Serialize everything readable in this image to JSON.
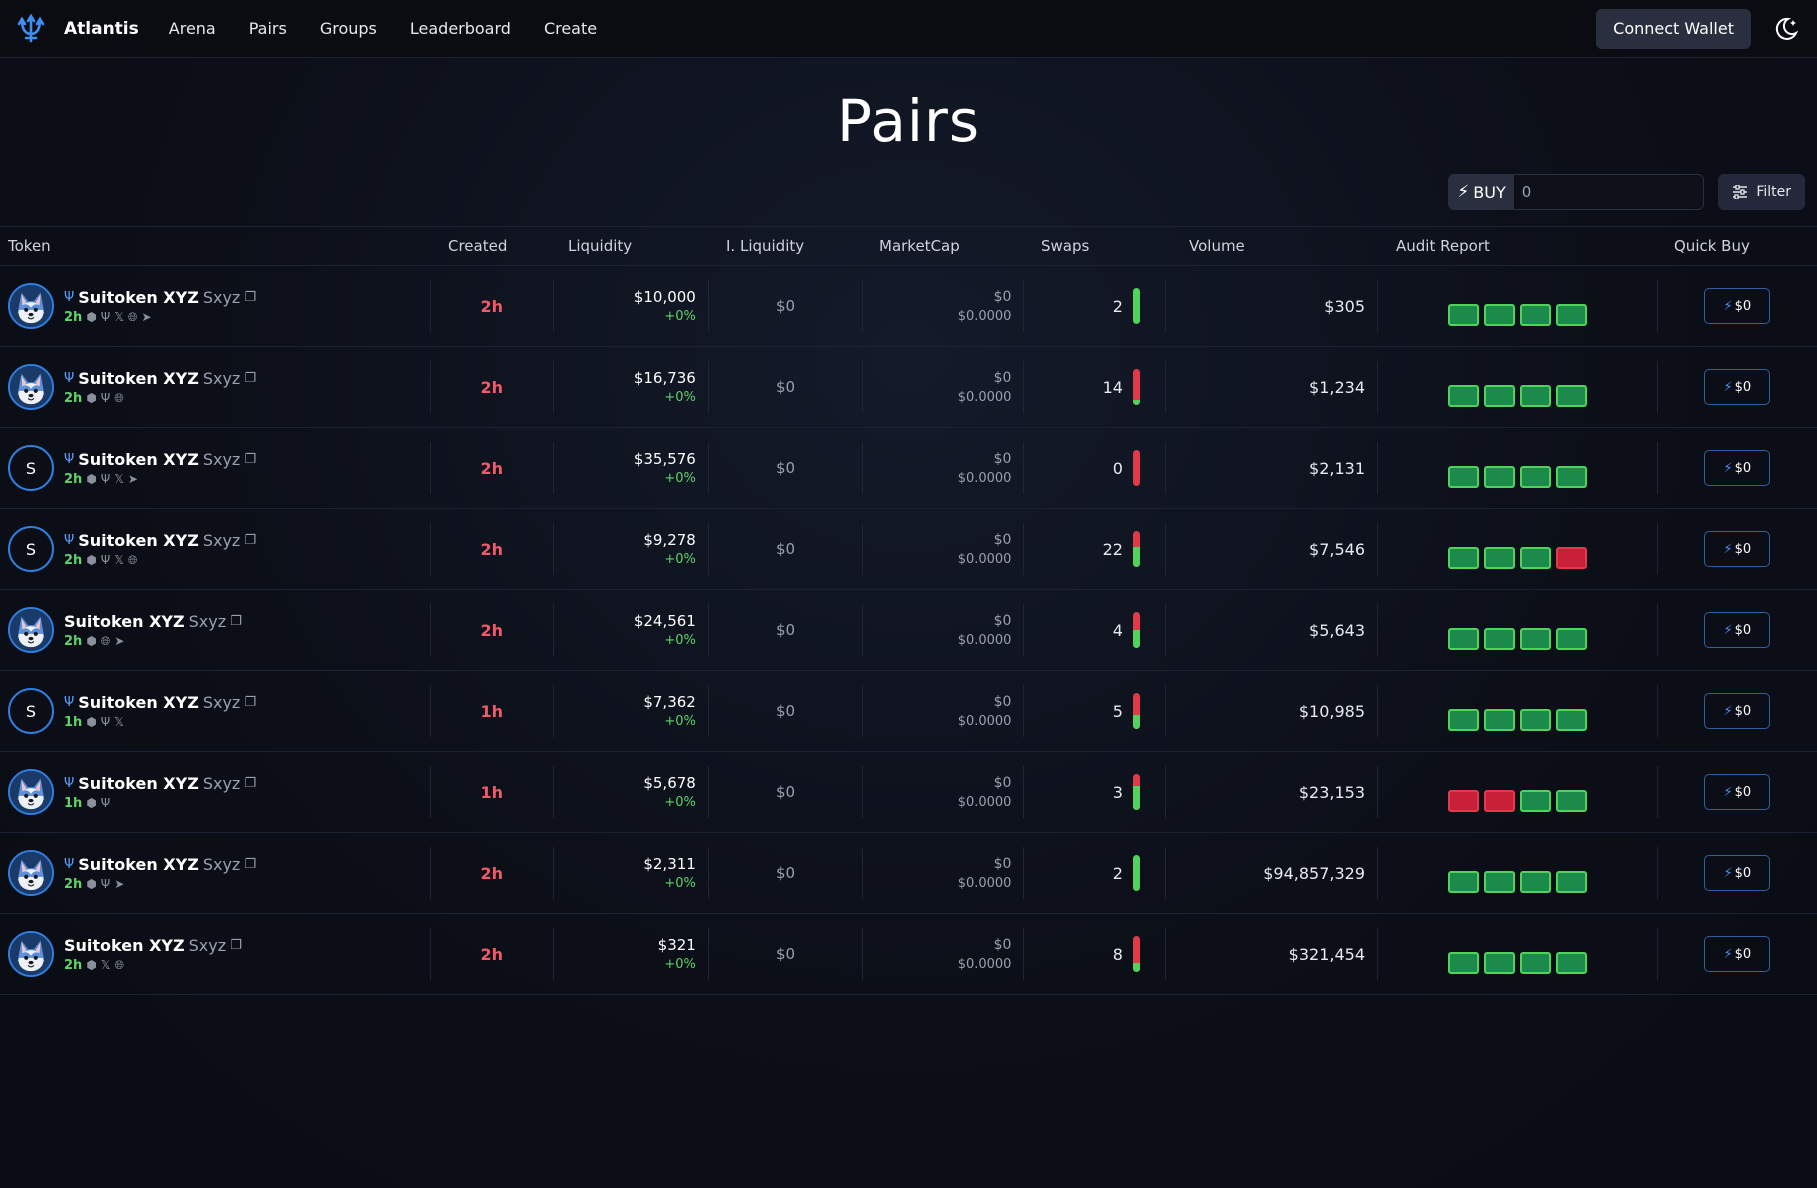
{
  "nav": {
    "brand": "Atlantis",
    "links": [
      "Arena",
      "Pairs",
      "Groups",
      "Leaderboard",
      "Create"
    ],
    "connect_label": "Connect Wallet"
  },
  "page": {
    "title": "Pairs"
  },
  "toolbar": {
    "buy_label": "BUY",
    "buy_value": "0",
    "filter_label": "Filter"
  },
  "table": {
    "headers": [
      "Token",
      "Created",
      "Liquidity",
      "I. Liquidity",
      "MarketCap",
      "Swaps",
      "Volume",
      "Audit Report",
      "Quick Buy"
    ],
    "rows": [
      {
        "avatar": "dog",
        "chain": true,
        "name": "Suitoken XYZ",
        "symbol": "Sxyz",
        "age": "2h",
        "socials": [
          "cube",
          "trident",
          "x",
          "globe",
          "telegram"
        ],
        "created": "2h",
        "liquidity": "$10,000",
        "liq_change": "+0%",
        "i_liquidity": "$0",
        "mcap": "$0",
        "price": "$0.0000",
        "swaps": "2",
        "swap_buy_ratio": 1.0,
        "volume": "$305",
        "audit": [
          "pass",
          "pass",
          "pass",
          "pass"
        ],
        "quick_buy": "$0"
      },
      {
        "avatar": "dog",
        "chain": true,
        "name": "Suitoken XYZ",
        "symbol": "Sxyz",
        "age": "2h",
        "socials": [
          "cube",
          "trident",
          "globe"
        ],
        "created": "2h",
        "liquidity": "$16,736",
        "liq_change": "+0%",
        "i_liquidity": "$0",
        "mcap": "$0",
        "price": "$0.0000",
        "swaps": "14",
        "swap_buy_ratio": 0.15,
        "volume": "$1,234",
        "audit": [
          "pass",
          "pass",
          "pass",
          "pass"
        ],
        "quick_buy": "$0"
      },
      {
        "avatar": "S",
        "chain": true,
        "name": "Suitoken XYZ",
        "symbol": "Sxyz",
        "age": "2h",
        "socials": [
          "cube",
          "trident",
          "x",
          "telegram"
        ],
        "created": "2h",
        "liquidity": "$35,576",
        "liq_change": "+0%",
        "i_liquidity": "$0",
        "mcap": "$0",
        "price": "$0.0000",
        "swaps": "0",
        "swap_buy_ratio": 0.0,
        "volume": "$2,131",
        "audit": [
          "pass",
          "pass",
          "pass",
          "pass"
        ],
        "quick_buy": "$0"
      },
      {
        "avatar": "S",
        "chain": true,
        "name": "Suitoken XYZ",
        "symbol": "Sxyz",
        "age": "2h",
        "socials": [
          "cube",
          "trident",
          "x",
          "globe"
        ],
        "created": "2h",
        "liquidity": "$9,278",
        "liq_change": "+0%",
        "i_liquidity": "$0",
        "mcap": "$0",
        "price": "$0.0000",
        "swaps": "22",
        "swap_buy_ratio": 0.55,
        "volume": "$7,546",
        "audit": [
          "pass",
          "pass",
          "pass",
          "fail"
        ],
        "quick_buy": "$0"
      },
      {
        "avatar": "dog",
        "chain": false,
        "name": "Suitoken XYZ",
        "symbol": "Sxyz",
        "age": "2h",
        "socials": [
          "cube",
          "globe",
          "telegram"
        ],
        "created": "2h",
        "liquidity": "$24,561",
        "liq_change": "+0%",
        "i_liquidity": "$0",
        "mcap": "$0",
        "price": "$0.0000",
        "swaps": "4",
        "swap_buy_ratio": 0.5,
        "volume": "$5,643",
        "audit": [
          "pass",
          "pass",
          "pass",
          "pass"
        ],
        "quick_buy": "$0"
      },
      {
        "avatar": "S",
        "chain": true,
        "name": "Suitoken XYZ",
        "symbol": "Sxyz",
        "age": "1h",
        "socials": [
          "cube",
          "trident",
          "x"
        ],
        "created": "1h",
        "liquidity": "$7,362",
        "liq_change": "+0%",
        "i_liquidity": "$0",
        "mcap": "$0",
        "price": "$0.0000",
        "swaps": "5",
        "swap_buy_ratio": 0.4,
        "volume": "$10,985",
        "audit": [
          "pass",
          "pass",
          "pass",
          "pass"
        ],
        "quick_buy": "$0"
      },
      {
        "avatar": "dog",
        "chain": true,
        "name": "Suitoken XYZ",
        "symbol": "Sxyz",
        "age": "1h",
        "socials": [
          "cube",
          "trident"
        ],
        "created": "1h",
        "liquidity": "$5,678",
        "liq_change": "+0%",
        "i_liquidity": "$0",
        "mcap": "$0",
        "price": "$0.0000",
        "swaps": "3",
        "swap_buy_ratio": 0.67,
        "volume": "$23,153",
        "audit": [
          "fail",
          "fail",
          "pass",
          "pass"
        ],
        "quick_buy": "$0"
      },
      {
        "avatar": "dog",
        "chain": true,
        "name": "Suitoken XYZ",
        "symbol": "Sxyz",
        "age": "2h",
        "socials": [
          "cube",
          "trident",
          "telegram"
        ],
        "created": "2h",
        "liquidity": "$2,311",
        "liq_change": "+0%",
        "i_liquidity": "$0",
        "mcap": "$0",
        "price": "$0.0000",
        "swaps": "2",
        "swap_buy_ratio": 1.0,
        "volume": "$94,857,329",
        "audit": [
          "pass",
          "pass",
          "pass",
          "pass"
        ],
        "quick_buy": "$0"
      },
      {
        "avatar": "dog",
        "chain": false,
        "name": "Suitoken XYZ",
        "symbol": "Sxyz",
        "age": "2h",
        "socials": [
          "cube",
          "x",
          "globe"
        ],
        "created": "2h",
        "liquidity": "$321",
        "liq_change": "+0%",
        "i_liquidity": "$0",
        "mcap": "$0",
        "price": "$0.0000",
        "swaps": "8",
        "swap_buy_ratio": 0.25,
        "volume": "$321,454",
        "audit": [
          "pass",
          "pass",
          "pass",
          "pass"
        ],
        "quick_buy": "$0"
      }
    ]
  },
  "colors": {
    "accent": "#2f7fe0",
    "buy": "#4fd35b",
    "sell": "#e03a48",
    "created": "#f05a6a",
    "audit_pass": "#1c8a4a",
    "audit_fail": "#c9203a"
  },
  "icons": {
    "logo": "trident-logo",
    "theme": "moon-icon",
    "filter": "sliders-icon",
    "bolt": "lightning-icon",
    "copy": "copy-icon"
  }
}
